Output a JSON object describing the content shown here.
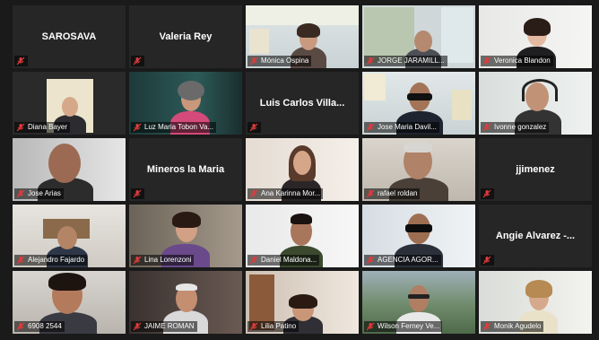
{
  "colors": {
    "tile_bg": "#262626",
    "active_border": "#9fd23a",
    "mic_muted": "#e23b3b"
  },
  "icons": {
    "mic": "mic-muted-icon"
  },
  "participants": [
    {
      "name": "SAROSAVA",
      "video": false
    },
    {
      "name": "Valeria Rey",
      "video": false
    },
    {
      "name": "Mónica Ospina",
      "video": true
    },
    {
      "name": "JORGE JARAMILL...",
      "video": true
    },
    {
      "name": "Veronica Blandon",
      "video": true
    },
    {
      "name": "Diana Bayer",
      "video": true
    },
    {
      "name": "Luz Maria Tobon Va...",
      "video": true
    },
    {
      "name": "Luis Carlos Villa...",
      "video": false
    },
    {
      "name": "Jose Maria Davil...",
      "video": true
    },
    {
      "name": "Ivonne gonzalez",
      "video": true
    },
    {
      "name": "Jose Arias",
      "video": true
    },
    {
      "name": "Mineros la Maria",
      "video": false
    },
    {
      "name": "Ana Karinna Mor...",
      "video": true
    },
    {
      "name": "rafael roldan",
      "video": true,
      "active": true
    },
    {
      "name": "jjimenez",
      "video": false
    },
    {
      "name": "Alejandro Fajardo",
      "video": true
    },
    {
      "name": "Lina Lorenzoni",
      "video": true
    },
    {
      "name": "Daniel Maldona...",
      "video": true
    },
    {
      "name": "AGENCIA AGOR...",
      "video": true
    },
    {
      "name": "Angie Alvarez -...",
      "video": false
    },
    {
      "name": "6908 2544",
      "video": true
    },
    {
      "name": "JAIME ROMAN",
      "video": true
    },
    {
      "name": "Lilia Patino",
      "video": true
    },
    {
      "name": "Wilson Ferney Ve...",
      "video": true
    },
    {
      "name": "Monik Agudelo",
      "video": true
    }
  ]
}
